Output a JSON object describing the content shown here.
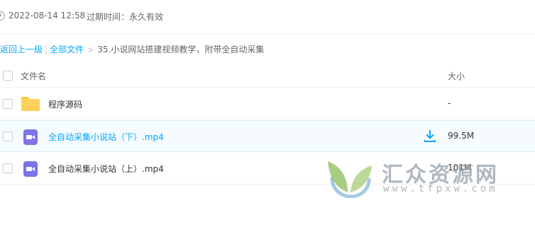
{
  "share_info": {
    "icon": "clock-icon",
    "date": "2022-08-14 12:58",
    "expiry": "过期时间：永久有效"
  },
  "breadcrumb": {
    "back": "返回上一级",
    "separator": "|",
    "all_files": "全部文件",
    "arrow": ">",
    "current": "35.小说网站搭建视频教学，附带全自动采集"
  },
  "table": {
    "header": {
      "name": "文件名",
      "size": "大小"
    },
    "rows": [
      {
        "name": "程序源码",
        "size": "-",
        "icon": "folder-icon"
      },
      {
        "name": "全自动采集小说站（下）.mp4",
        "size": "99.5M",
        "icon": "video-file-icon",
        "hovered": true
      },
      {
        "name": "全自动采集小说站（上）.mp4",
        "size": "101M",
        "icon": "video-file-icon"
      }
    ]
  },
  "watermark": {
    "title": "汇众资源网",
    "url": "www.tfpxw.com"
  },
  "colors": {
    "link": "#06a7ff",
    "folder": "#ffd05b",
    "video_icon": "#7b73e8",
    "hover_row": "#f5fbff"
  }
}
